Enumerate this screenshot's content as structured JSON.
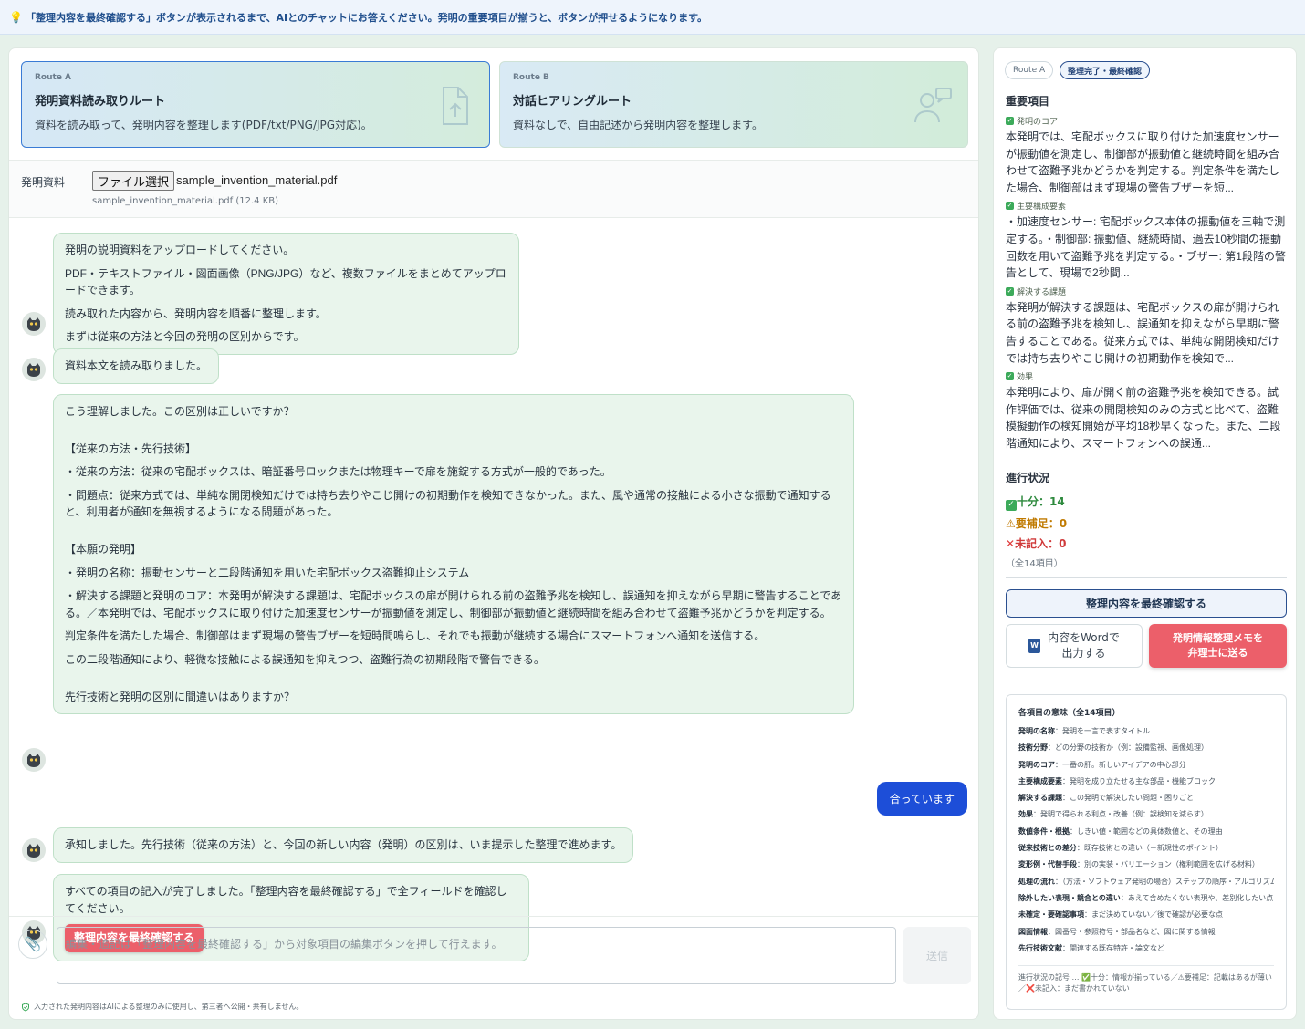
{
  "banner": {
    "text": "「整理内容を最終確認する」ボタンが表示されるまで、AIとのチャットにお答えください。発明の重要項目が揃うと、ボタンが押せるようになります。"
  },
  "routes": [
    {
      "tag": "Route A",
      "title": "発明資料読み取りルート",
      "desc": "資料を読み取って、発明内容を整理します(PDF/txt/PNG/JPG対応)。",
      "icon": "upload-file-icon"
    },
    {
      "tag": "Route B",
      "title": "対話ヒアリングルート",
      "desc": "資料なしで、自由記述から発明内容を整理します。",
      "icon": "user-chat-icon"
    }
  ],
  "file": {
    "label": "発明資料",
    "button": "ファイル選択",
    "name": "sample_invention_material.pdf",
    "meta": "sample_invention_material.pdf (12.4 KB)"
  },
  "chat": {
    "m1": [
      "発明の説明資料をアップロードしてください。",
      "PDF・テキストファイル・図面画像（PNG/JPG）など、複数ファイルをまとめてアップロードできます。",
      "読み取れた内容から、発明内容を順番に整理します。",
      "まずは従来の方法と今回の発明の区別からです。"
    ],
    "m2": "資料本文を読み取りました。",
    "m3": {
      "intro": "こう理解しました。この区別は正しいですか？",
      "h1": "【従来の方法・先行技術】",
      "p1": "・従来の方法：従来の宅配ボックスは、暗証番号ロックまたは物理キーで扉を施錠する方式が一般的であった。",
      "p2": "・問題点：従来方式では、単純な開閉検知だけでは持ち去りやこじ開けの初期動作を検知できなかった。また、風や通常の接触による小さな振動で通知すると、利用者が通知を無視するようになる問題があった。",
      "h2": "【本願の発明】",
      "p3": "・発明の名称：振動センサーと二段階通知を用いた宅配ボックス盗難抑止システム",
      "p4": "・解決する課題と発明のコア：本発明が解決する課題は、宅配ボックスの扉が開けられる前の盗難予兆を検知し、誤通知を抑えながら早期に警告することである。／本発明では、宅配ボックスに取り付けた加速度センサーが振動値を測定し、制御部が振動値と継続時間を組み合わせて盗難予兆かどうかを判定する。",
      "p5": "判定条件を満たした場合、制御部はまず現場の警告ブザーを短時間鳴らし、それでも振動が継続する場合にスマートフォンへ通知を送信する。",
      "p6": "この二段階通知により、軽微な接触による誤通知を抑えつつ、盗難行為の初期段階で警告できる。",
      "outro": "先行技術と発明の区別に間違いはありますか？"
    },
    "user": "合っています",
    "m4": "承知しました。先行技術（従来の方法）と、今回の新しい内容（発明）の区別は、いま提示した整理で進めます。",
    "m5": "すべての項目の記入が完了しました。「整理内容を最終確認する」で全フィールドを確認してください。",
    "m5_button": "整理内容を最終確認する"
  },
  "input": {
    "placeholder": "編集・追記は「整理内容を最終確認する」から対象項目の編集ボタンを押して行えます。",
    "send": "送信",
    "privacy": "入力された発明内容はAIによる整理のみに使用し、第三者へ公開・共有しません。"
  },
  "side": {
    "pill_route": "Route A",
    "pill_status": "整理完了・最終確認",
    "important_title": "重要項目",
    "items": [
      {
        "label": "発明のコア",
        "text": "本発明では、宅配ボックスに取り付けた加速度センサーが振動値を測定し、制御部が振動値と継続時間を組み合わせて盗難予兆かどうかを判定する。判定条件を満たした場合、制御部はまず現場の警告ブザーを短..."
      },
      {
        "label": "主要構成要素",
        "text": "・加速度センサー: 宅配ボックス本体の振動値を三軸で測定する。・制御部: 振動値、継続時間、過去10秒間の振動回数を用いて盗難予兆を判定する。・ブザー: 第1段階の警告として、現場で2秒間..."
      },
      {
        "label": "解決する課題",
        "text": "本発明が解決する課題は、宅配ボックスの扉が開けられる前の盗難予兆を検知し、誤通知を抑えながら早期に警告することである。従来方式では、単純な開閉検知だけでは持ち去りやこじ開けの初期動作を検知で..."
      },
      {
        "label": "効果",
        "text": "本発明により、扉が開く前の盗難予兆を検知できる。試作評価では、従来の開閉検知のみの方式と比べて、盗難模擬動作の検知開始が平均18秒早くなった。また、二段階通知により、スマートフォンへの誤通..."
      }
    ],
    "progress_title": "進行状況",
    "sufficient": "十分：14",
    "needs": "⚠要補足：0",
    "missing": "未記入：0",
    "total": "（全14項目）",
    "confirm": "整理内容を最終確認する",
    "word": "内容をWordで出力する",
    "word_line1": "内容をWordで",
    "word_line2": "出力する",
    "memo_line1": "発明情報整理メモを",
    "memo_line2": "弁理士に送る",
    "legend_title": "各項目の意味（全14項目）",
    "legend": [
      {
        "k": "発明の名称",
        "v": "：発明を一言で表すタイトル"
      },
      {
        "k": "技術分野",
        "v": "：どの分野の技術か（例：設備監視、画像処理）"
      },
      {
        "k": "発明のコア",
        "v": "：一番の肝。新しいアイデアの中心部分"
      },
      {
        "k": "主要構成要素",
        "v": "：発明を成り立たせる主な部品・機能ブロック"
      },
      {
        "k": "解決する課題",
        "v": "：この発明で解決したい問題・困りごと"
      },
      {
        "k": "効果",
        "v": "：発明で得られる利点・改善（例：誤検知を減らす）"
      },
      {
        "k": "数値条件・根拠",
        "v": "：しきい値・範囲などの具体数値と、その理由"
      },
      {
        "k": "従来技術との差分",
        "v": "：既存技術との違い（＝新規性のポイント）"
      },
      {
        "k": "変形例・代替手段",
        "v": "：別の実装・バリエーション（権利範囲を広げる材料）"
      },
      {
        "k": "処理の流れ",
        "v": "：（方法・ソフトウェア発明の場合）ステップの順序・アルゴリズム"
      },
      {
        "k": "除外したい表現・競合との違い",
        "v": "：あえて含めたくない表現や、差別化したい点"
      },
      {
        "k": "未確定・要確認事項",
        "v": "：まだ決めていない／後で確認が必要な点"
      },
      {
        "k": "図面情報",
        "v": "：図番号・参照符号・部品名など、図に関する情報"
      },
      {
        "k": "先行技術文献",
        "v": "：関連する既存特許・論文など"
      }
    ],
    "legend_foot": "進行状況の記号 … ✅十分：情報が揃っている／⚠要補足：記載はあるが薄い／❌未記入：まだ書かれていない"
  },
  "colors": {
    "accent_blue": "#1d4ed8",
    "red_button": "#ec5f6a",
    "bubble_green": "#e9f5ec",
    "check_green": "#3caa5a"
  }
}
